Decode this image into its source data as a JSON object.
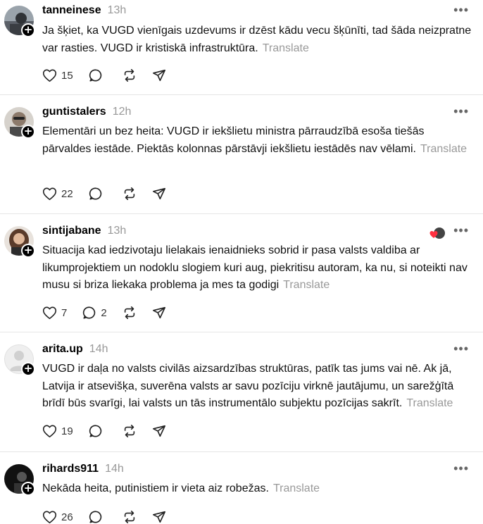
{
  "translate_label": "Translate",
  "colors": {
    "accent": "#ff3040",
    "muted": "#999999",
    "text": "#111111"
  },
  "posts": [
    {
      "username": "tanneinese",
      "time": "13h",
      "text": "Ja šķiet, ka VUGD vienīgais uzdevums ir dzēst kādu vecu šķūnīti, tad šāda neizpratne var rasties. VUGD ir kristiskā infrastruktūra.",
      "likes": "15",
      "replies": ""
    },
    {
      "username": "guntistalers",
      "time": "12h",
      "text": "Elementāri un bez heita: VUGD ir iekšlietu ministra pārraudzībā esoša tiešās pārvaldes iestāde. Piektās kolonnas pārstāvji iekšlietu iestādēs nav vēlami.",
      "likes": "22",
      "replies": ""
    },
    {
      "username": "sintijabane",
      "time": "13h",
      "text": "Situacija kad iedzivotaju lielakais ienaidnieks sobrid ir pasa valsts valdiba ar likumprojektiem un nodoklu slogiem kuri aug, piekritisu autoram, ka nu, si noteikti nav musu si briza liekaka problema ja mes ta godigi",
      "likes": "7",
      "replies": "2"
    },
    {
      "username": "arita.up",
      "time": "14h",
      "text": "VUGD ir daļa no valsts civilās aizsardzības struktūras, patīk tas jums vai nē. Ak jā, Latvija ir atsevišķa, suverēna valsts ar savu pozīciju virknē jautājumu, un sarežģītā brīdī būs svarīgi, lai valsts un tās instrumentālo subjektu pozīcijas sakrīt.",
      "likes": "19",
      "replies": ""
    },
    {
      "username": "rihards911",
      "time": "14h",
      "text": "Nekāda heita, putinistiem ir vieta aiz robežas.",
      "likes": "26",
      "replies": ""
    }
  ]
}
